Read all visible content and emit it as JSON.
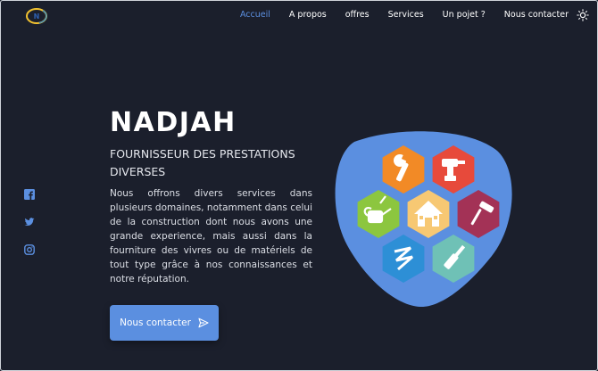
{
  "header": {
    "logo_alt": "Nadjah logo",
    "nav": [
      {
        "label": "Accueil",
        "active": true
      },
      {
        "label": "A propos"
      },
      {
        "label": "offres"
      },
      {
        "label": "Services"
      },
      {
        "label": "Un pojet ?"
      },
      {
        "label": "Nous contacter"
      }
    ],
    "theme_icon": "sun-icon"
  },
  "social": [
    "facebook-icon",
    "twitter-icon",
    "instagram-icon"
  ],
  "hero": {
    "title": "NADJAH",
    "subtitle": "FOURNISSEUR DES PRESTATIONS DIVERSES",
    "description": "Nous offrons divers services dans plusieurs domaines, notamment dans celui de la construction dont nous avons une grande experience, mais aussi dans la fourniture des vivres ou de matériels de tout type grâce à nos connaissances et notre réputation.",
    "cta_label": "Nous contacter",
    "cta_icon": "send-icon"
  },
  "colors": {
    "background": "#1b1f2c",
    "accent": "#5b8fe0",
    "hex_orange": "#f28a26",
    "hex_red": "#e74a3b",
    "hex_green": "#8cc63f",
    "hex_yellow": "#f7c873",
    "hex_maroon": "#a33256",
    "hex_blue": "#2d8fd6",
    "hex_teal": "#6fc1b6"
  }
}
